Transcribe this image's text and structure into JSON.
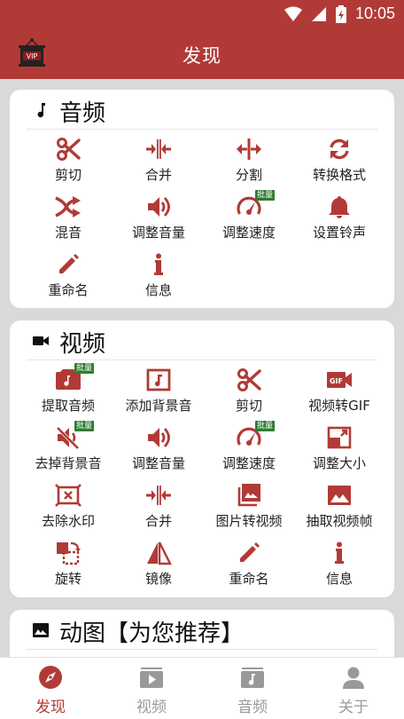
{
  "status_bar": {
    "time": "10:05"
  },
  "app_bar": {
    "title": "发现",
    "vip_text": "VIP"
  },
  "audio": {
    "title": "音频",
    "items": [
      {
        "label": "剪切",
        "icon": "scissors-icon"
      },
      {
        "label": "合并",
        "icon": "merge-icon"
      },
      {
        "label": "分割",
        "icon": "split-icon"
      },
      {
        "label": "转换格式",
        "icon": "convert-icon"
      },
      {
        "label": "混音",
        "icon": "mix-icon"
      },
      {
        "label": "调整音量",
        "icon": "volume-icon"
      },
      {
        "label": "调整速度",
        "icon": "speed-icon",
        "badge": "批量"
      },
      {
        "label": "设置铃声",
        "icon": "bell-icon"
      },
      {
        "label": "重命名",
        "icon": "pencil-icon"
      },
      {
        "label": "信息",
        "icon": "info-icon"
      }
    ]
  },
  "video": {
    "title": "视频",
    "items": [
      {
        "label": "提取音频",
        "icon": "extract-audio-icon",
        "badge": "批量"
      },
      {
        "label": "添加背景音",
        "icon": "music-note-icon"
      },
      {
        "label": "剪切",
        "icon": "scissors-icon"
      },
      {
        "label": "视频转GIF",
        "icon": "gif-icon",
        "icon_text": "GIF"
      },
      {
        "label": "去掉背景音",
        "icon": "mute-icon",
        "badge": "批量"
      },
      {
        "label": "调整音量",
        "icon": "volume-icon"
      },
      {
        "label": "调整速度",
        "icon": "speed-icon",
        "badge": "批量"
      },
      {
        "label": "调整大小",
        "icon": "resize-icon"
      },
      {
        "label": "去除水印",
        "icon": "remove-watermark-icon"
      },
      {
        "label": "合并",
        "icon": "merge-icon"
      },
      {
        "label": "图片转视频",
        "icon": "photos-icon"
      },
      {
        "label": "抽取视频帧",
        "icon": "image-icon"
      },
      {
        "label": "旋转",
        "icon": "rotate-icon"
      },
      {
        "label": "镜像",
        "icon": "mirror-icon"
      },
      {
        "label": "重命名",
        "icon": "pencil-icon"
      },
      {
        "label": "信息",
        "icon": "info-icon"
      }
    ]
  },
  "gif": {
    "title": "动图【为您推荐】"
  },
  "bottom_nav": [
    {
      "label": "发现",
      "icon": "compass-icon",
      "active": true
    },
    {
      "label": "视频",
      "icon": "video-tab-icon"
    },
    {
      "label": "音频",
      "icon": "audio-tab-icon"
    },
    {
      "label": "关于",
      "icon": "person-icon"
    }
  ],
  "colors": {
    "accent": "#b13a36",
    "badge": "#2e7d32",
    "inactive": "#999999"
  }
}
